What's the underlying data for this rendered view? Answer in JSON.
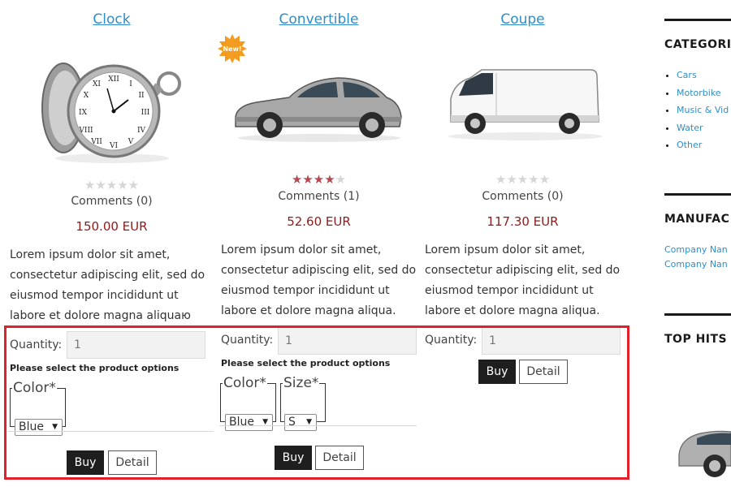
{
  "products": [
    {
      "title": "Clock",
      "rating_stars": 0,
      "comments": "Comments (0)",
      "price": "150.00 EUR",
      "description": "Lorem ipsum dolor sit amet, consectetur adipiscing elit, sed do eiusmod tempor incididunt ut labore et dolore magna aliquaю",
      "quantity_label": "Quantity:",
      "quantity_value": "1",
      "options_note": "Please select the product options",
      "options": [
        {
          "label": "Color*",
          "selected": "Blue"
        }
      ],
      "buy_label": "Buy",
      "detail_label": "Detail",
      "image_icon": "pocket-watch-image"
    },
    {
      "title": "Convertible",
      "badge": "New!",
      "rating_stars": 4,
      "comments": "Comments (1)",
      "price": "52.60 EUR",
      "description": "Lorem ipsum dolor sit amet, consectetur adipiscing elit, sed do eiusmod tempor incididunt ut labore et dolore magna aliqua.",
      "quantity_label": "Quantity:",
      "quantity_value": "1",
      "options_note": "Please select the product options",
      "options": [
        {
          "label": "Color*",
          "selected": "Blue"
        },
        {
          "label": "Size*",
          "selected": "S"
        }
      ],
      "buy_label": "Buy",
      "detail_label": "Detail",
      "image_icon": "silver-hatchback-car-image"
    },
    {
      "title": "Coupe",
      "rating_stars": 0,
      "comments": "Comments (0)",
      "price": "117.30 EUR",
      "description": "Lorem ipsum dolor sit amet, consectetur adipiscing elit, sed do eiusmod tempor incididunt ut labore et dolore magna aliqua.",
      "quantity_label": "Quantity:",
      "quantity_value": "1",
      "buy_label": "Buy",
      "detail_label": "Detail",
      "image_icon": "white-van-image"
    }
  ],
  "sidebar": {
    "categories_heading": "CATEGORI",
    "categories": [
      "Cars",
      "Motorbike",
      "Music & Vid",
      "Water",
      "Other"
    ],
    "manufacturers_heading": "MANUFAC",
    "manufacturers": [
      "Company Nan",
      "Company Nan"
    ],
    "tophits_heading": "TOP HITS I"
  },
  "colors": {
    "link": "#2f8ec6",
    "price": "#8b1c1c",
    "star_on": "#b54952",
    "star_off": "#d6d6d6",
    "highlight": "#e0202b",
    "buy_bg": "#1e1e1e"
  }
}
